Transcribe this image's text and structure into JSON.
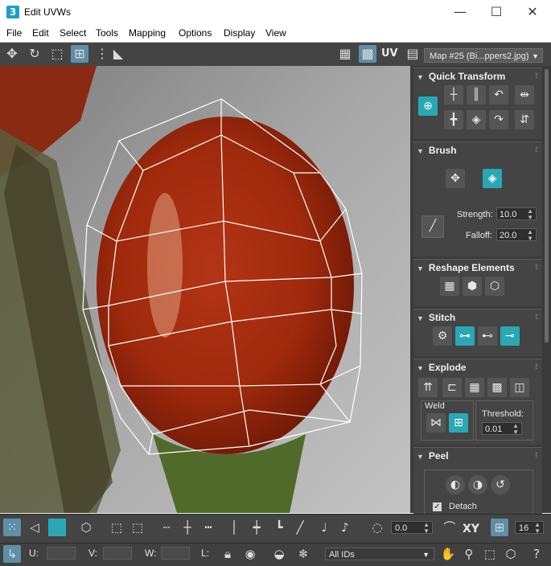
{
  "window": {
    "app_badge": "3",
    "title": "Edit UVWs",
    "minimize_glyph": "—",
    "maximize_glyph": "☐",
    "close_glyph": "✕"
  },
  "menu": {
    "items": [
      "File",
      "Edit",
      "Select",
      "Tools",
      "Mapping",
      "Options",
      "Display",
      "View"
    ]
  },
  "toolbar": {
    "uv_label": "UV",
    "map_select": "Map #25 (Bi...ppers2.jpg)",
    "icons": [
      "move-icon",
      "rotate-icon",
      "scale-icon",
      "freeform-icon",
      "mirror-icon",
      "checker-icon",
      "checker-active-icon",
      "map-settings-icon"
    ]
  },
  "panel": {
    "quick_transform": {
      "title": "Quick Transform"
    },
    "brush": {
      "title": "Brush",
      "strength_label": "Strength:",
      "strength_value": "10.0",
      "falloff_label": "Falloff:",
      "falloff_value": "20.0"
    },
    "reshape": {
      "title": "Reshape Elements"
    },
    "stitch": {
      "title": "Stitch"
    },
    "explode": {
      "title": "Explode",
      "weld_label": "Weld",
      "threshold_label": "Threshold:",
      "threshold_value": "0.01"
    },
    "peel": {
      "title": "Peel",
      "detach_label": "Detach",
      "detach_checked": true
    }
  },
  "bottom": {
    "rotate_value": "0.0",
    "xy_label": "XY",
    "grid_value": "16",
    "u_label": "U:",
    "v_label": "V:",
    "w_label": "W:",
    "l_label": "L:",
    "ids_select": "All IDs"
  },
  "colors": {
    "accent": "#2aa7b5",
    "active_toolbar": "#5f8fa8",
    "panel_bg": "#3c3c3c"
  }
}
